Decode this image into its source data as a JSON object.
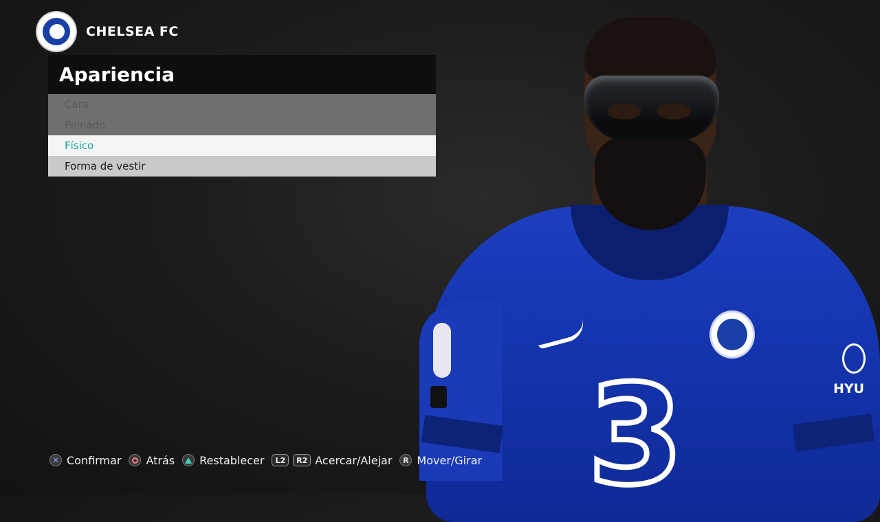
{
  "header": {
    "club_name": "CHELSEA FC",
    "crest_icon": "chelsea-crest-icon"
  },
  "panel": {
    "title": "Apariencia",
    "items": [
      {
        "label": "Cara",
        "state": "disabled"
      },
      {
        "label": "Peinado",
        "state": "disabled"
      },
      {
        "label": "Físico",
        "state": "selected"
      },
      {
        "label": "Forma de vestir",
        "state": "normal"
      }
    ]
  },
  "player": {
    "sleeve_sponsor": "HYU"
  },
  "hints": [
    {
      "icon": "cross-button-icon",
      "label": "Confirmar"
    },
    {
      "icon": "circle-button-icon",
      "label": "Atrás"
    },
    {
      "icon": "triangle-button-icon",
      "label": "Restablecer"
    },
    {
      "icon_l2": "L2",
      "icon_r2": "R2",
      "label": "Acercar/Alejar"
    },
    {
      "icon_r": "R",
      "label": "Mover/Girar"
    }
  ],
  "colors": {
    "accent_selected": "#1ba6a0",
    "jersey_blue": "#1535b0"
  }
}
